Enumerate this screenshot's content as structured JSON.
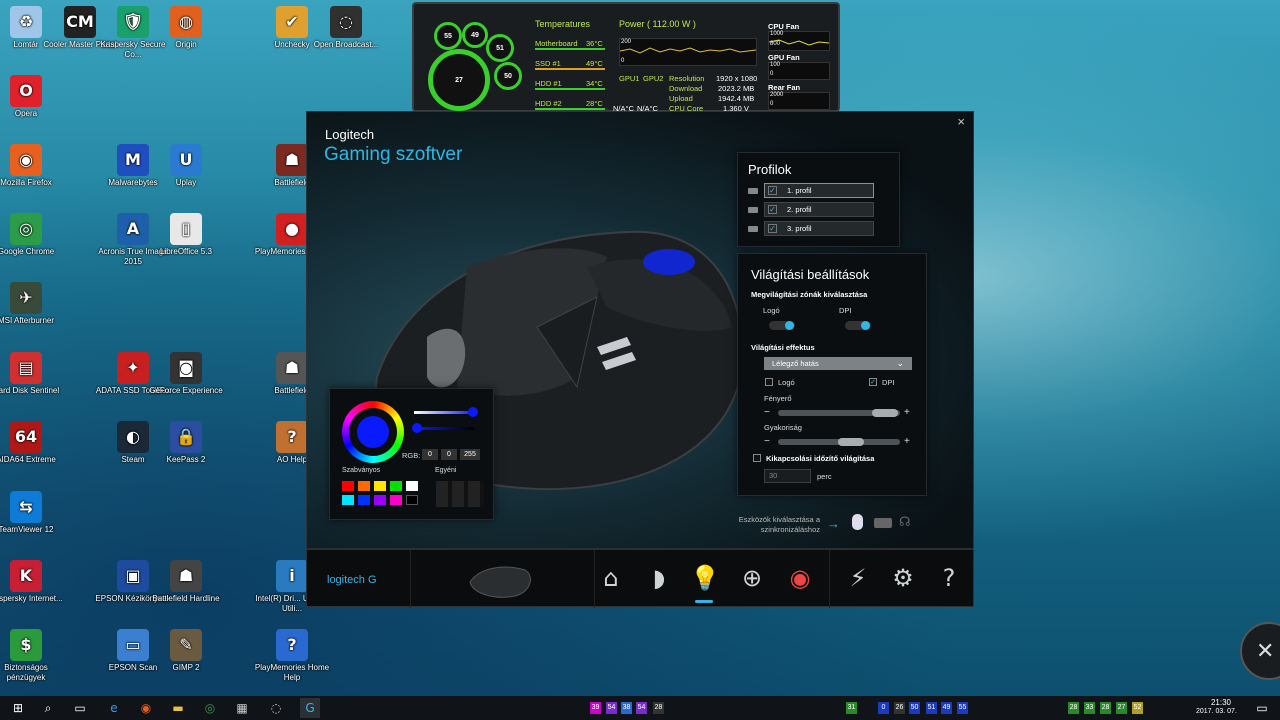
{
  "desktop_icons": [
    {
      "label": "Lomtár",
      "icon": "recycle-bin-icon",
      "glyph": "♻",
      "color": "#9fc6e8"
    },
    {
      "label": "Opera",
      "icon": "opera-icon",
      "glyph": "O",
      "color": "#e0202a"
    },
    {
      "label": "Mozilla Firefox",
      "icon": "firefox-icon",
      "glyph": "◉",
      "color": "#e66020"
    },
    {
      "label": "Google Chrome",
      "icon": "chrome-icon",
      "glyph": "◎",
      "color": "#2c9c48"
    },
    {
      "label": "MSI Afterburner",
      "icon": "msi-afterburner-icon",
      "glyph": "✈",
      "color": "#3a4a3a"
    },
    {
      "label": "Hard Disk Sentinel",
      "icon": "hard-disk-sentinel-icon",
      "glyph": "▤",
      "color": "#d03030"
    },
    {
      "label": "AIDA64 Extreme",
      "icon": "aida64-icon",
      "glyph": "64",
      "color": "#b01818"
    },
    {
      "label": "TeamViewer 12",
      "icon": "teamviewer-icon",
      "glyph": "⇆",
      "color": "#0e7bd6"
    },
    {
      "label": "Kaspersky Internet...",
      "icon": "kaspersky-icon",
      "glyph": "K",
      "color": "#c81f34"
    },
    {
      "label": "Biztonságos pénzügyek",
      "icon": "safe-money-icon",
      "glyph": "$",
      "color": "#2a9a3a"
    },
    {
      "label": "Cooler Master Portal",
      "icon": "cooler-master-icon",
      "glyph": "CM",
      "color": "#222"
    },
    {
      "label": "Malwarebytes",
      "icon": "malwarebytes-icon",
      "glyph": "M",
      "color": "#1f4fbf"
    },
    {
      "label": "Acronis True Image 2015",
      "icon": "acronis-icon",
      "glyph": "A",
      "color": "#1d5fa8"
    },
    {
      "label": "ADATA SSD ToolBox",
      "icon": "adata-icon",
      "glyph": "✦",
      "color": "#c82020"
    },
    {
      "label": "Steam",
      "icon": "steam-icon",
      "glyph": "◐",
      "color": "#1b2838"
    },
    {
      "label": "EPSON Kézikönyvek",
      "icon": "epson-manual-icon",
      "glyph": "▣",
      "color": "#1e4ba0"
    },
    {
      "label": "EPSON Scan",
      "icon": "epson-scan-icon",
      "glyph": "▭",
      "color": "#3a7fd0"
    },
    {
      "label": "Kaspersky Secure Co...",
      "icon": "kaspersky-secure-icon",
      "glyph": "🛡",
      "color": "#1aa06a"
    },
    {
      "label": "Uplay",
      "icon": "uplay-icon",
      "glyph": "U",
      "color": "#2a7ad0"
    },
    {
      "label": "LibreOffice 5.3",
      "icon": "libreoffice-icon",
      "glyph": "▯",
      "color": "#e8e8e8"
    },
    {
      "label": "GeForce Experience",
      "icon": "geforce-icon",
      "glyph": "◙",
      "color": "#333"
    },
    {
      "label": "KeePass 2",
      "icon": "keepass-icon",
      "glyph": "🔒",
      "color": "#2b4ea0"
    },
    {
      "label": "Battlefield Hardline",
      "icon": "bf-hardline-icon",
      "glyph": "☗",
      "color": "#444"
    },
    {
      "label": "GIMP 2",
      "icon": "gimp-icon",
      "glyph": "✎",
      "color": "#6a5a40"
    },
    {
      "label": "Origin",
      "icon": "origin-icon",
      "glyph": "◍",
      "color": "#e06020"
    },
    {
      "label": "Unchecky",
      "icon": "unchecky-icon",
      "glyph": "✔",
      "color": "#e0a030"
    },
    {
      "label": "Battlefield",
      "icon": "battlefield-icon",
      "glyph": "☗",
      "color": "#7a2a20"
    },
    {
      "label": "PlayMemories Home",
      "icon": "playmemories-icon",
      "glyph": "●",
      "color": "#d02020"
    },
    {
      "label": "Battlefield",
      "icon": "battlefield-4-icon",
      "glyph": "☗",
      "color": "#555"
    },
    {
      "label": "AO Help",
      "icon": "ao-help-icon",
      "glyph": "?",
      "color": "#c07030"
    },
    {
      "label": "Intel(R) Dri... Update Utili...",
      "icon": "intel-driver-icon",
      "glyph": "i",
      "color": "#2a7ac0"
    },
    {
      "label": "PlayMemories Home Help",
      "icon": "help-icon",
      "glyph": "?",
      "color": "#2a6ad0"
    },
    {
      "label": "Open Broadcast...",
      "icon": "obs-icon",
      "glyph": "◌",
      "color": "#303030"
    }
  ],
  "widget": {
    "gauges": [
      "55",
      "49",
      "51",
      "27",
      "50"
    ],
    "temperatures_title": "Temperatures",
    "power_title": "Power  ( 112.00 W )",
    "rows": [
      {
        "label": "Motherboard",
        "value": "36°C"
      },
      {
        "label": "SSD #1",
        "value": "49°C"
      },
      {
        "label": "HDD #1",
        "value": "34°C"
      },
      {
        "label": "HDD #2",
        "value": "28°C"
      }
    ],
    "gpu1": "GPU1",
    "gpu2": "GPU2",
    "gpu1_val": "N/A°C",
    "gpu2_val": "N/A°C",
    "graph_top": "200",
    "graph_bot": "0",
    "stats": [
      {
        "label": "Resolution",
        "value": "1920 x 1080"
      },
      {
        "label": "Download",
        "value": "2023.2 MB"
      },
      {
        "label": "Upload",
        "value": "1942.4 MB"
      },
      {
        "label": "CPU Core",
        "value": "1.360 V"
      }
    ],
    "fans": [
      {
        "label": "CPU Fan",
        "top": "1000",
        "mid": "800"
      },
      {
        "label": "GPU Fan",
        "top": "100",
        "mid": "0"
      },
      {
        "label": "Rear Fan",
        "top": "2000",
        "mid": "0"
      }
    ]
  },
  "app": {
    "brand_line1": "Logitech",
    "brand_line2": "Gaming szoftver",
    "close": "×",
    "profiles": {
      "title": "Profilok",
      "items": [
        "1. profil",
        "2. profil",
        "3. profil"
      ]
    },
    "lighting": {
      "title": "Világítási beállítások",
      "zones_heading": "Megvilágítási zónák kiválasztása",
      "zone_logo": "Logó",
      "zone_dpi": "DPI",
      "effect_heading": "Világítási effektus",
      "effect_value": "Lélegző hatás",
      "chk_logo": "Logó",
      "chk_dpi": "DPI",
      "brightness": "Fényerő",
      "frequency": "Gyakoriság",
      "timeout_label": "Kikapcsolási időzítő világítása",
      "timeout_value": "30",
      "timeout_unit": "perc",
      "minus": "−",
      "plus": "+"
    },
    "color": {
      "rgb_label": "RGB:",
      "r": "0",
      "g": "0",
      "b": "255",
      "standard": "Szabványos",
      "custom": "Egyéni",
      "swatches": [
        "#ff0000",
        "#ff6a00",
        "#ffe400",
        "#00e000",
        "#ffffff",
        "#00e5ff",
        "#0030ff",
        "#9a00ff",
        "#ff00c8",
        "#000000"
      ]
    },
    "sync_text": "Eszközök kiválasztása a szinkronizáláshoz",
    "footer_logo": "logitech"
  },
  "taskbar": {
    "time": "21:30",
    "date": "2017. 03. 07.",
    "tray_values": [
      "39",
      "54",
      "38",
      "54",
      "28",
      "31",
      "0",
      "26",
      "50",
      "51",
      "49",
      "55",
      "28",
      "33",
      "28",
      "27",
      "52"
    ]
  }
}
